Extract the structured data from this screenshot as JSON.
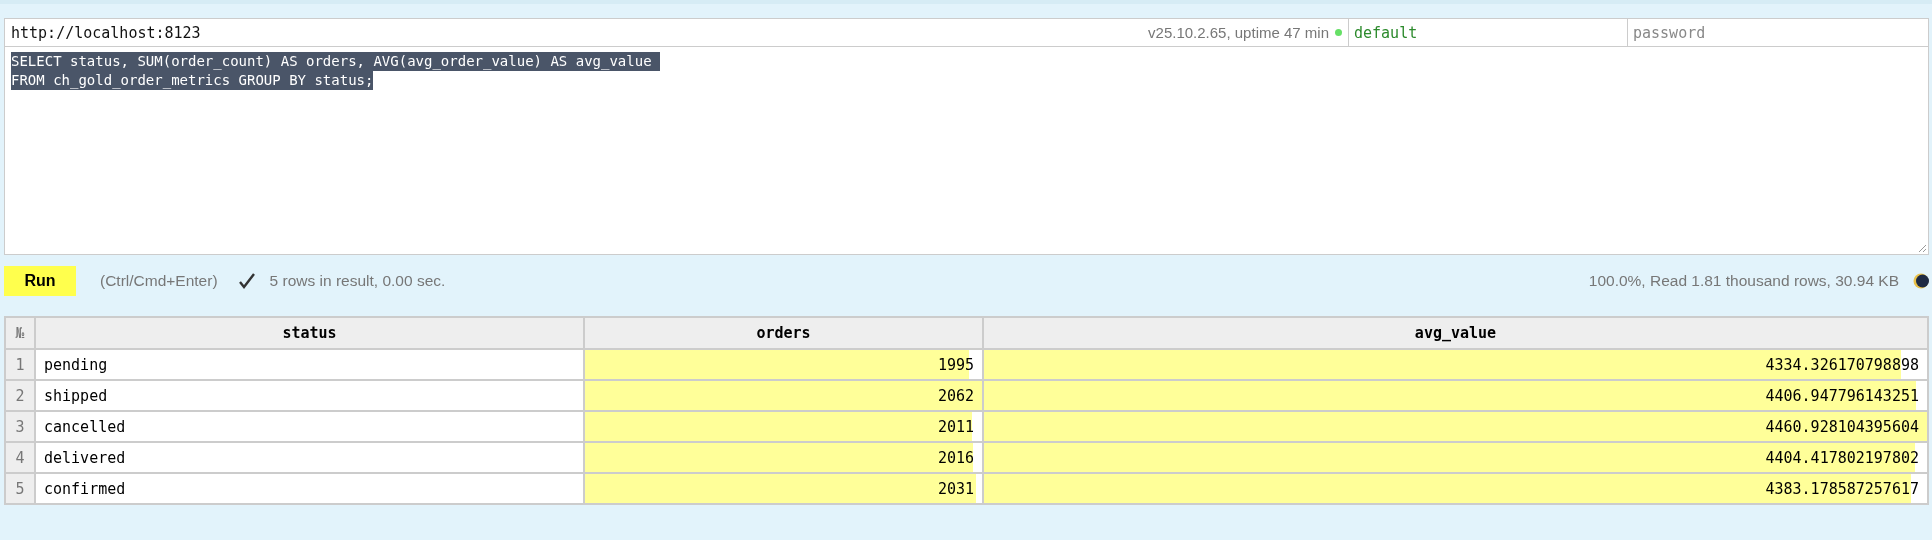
{
  "connection": {
    "url": "http://localhost:8123",
    "server_info": "v25.10.2.65, uptime 47 min",
    "online": true,
    "user": "default",
    "password_placeholder": "password"
  },
  "query": {
    "lines": [
      "SELECT status, SUM(order_count) AS orders, AVG(avg_order_value) AS avg_value ",
      "FROM ch_gold_order_metrics GROUP BY status;"
    ],
    "selected": true
  },
  "toolbar": {
    "run_label": "Run",
    "hint": "(Ctrl/Cmd+Enter)",
    "success": true,
    "result_summary": "5 rows in result, 0.00 sec.",
    "stats": "100.0%, Read 1.81 thousand rows, 30.94 KB"
  },
  "table": {
    "index_header": "№",
    "columns": [
      {
        "name": "status",
        "kind": "text"
      },
      {
        "name": "orders",
        "kind": "number"
      },
      {
        "name": "avg_value",
        "kind": "number"
      }
    ],
    "rows": [
      {
        "index": "1",
        "cells": [
          {
            "value": "pending"
          },
          {
            "value": "1995",
            "level": 0.967
          },
          {
            "value": "4334.326170798898",
            "level": 0.972
          }
        ]
      },
      {
        "index": "2",
        "cells": [
          {
            "value": "shipped"
          },
          {
            "value": "2062",
            "level": 1
          },
          {
            "value": "4406.947796143251",
            "level": 0.988
          }
        ]
      },
      {
        "index": "3",
        "cells": [
          {
            "value": "cancelled"
          },
          {
            "value": "2011",
            "level": 0.975
          },
          {
            "value": "4460.928104395604",
            "level": 1
          }
        ]
      },
      {
        "index": "4",
        "cells": [
          {
            "value": "delivered"
          },
          {
            "value": "2016",
            "level": 0.978
          },
          {
            "value": "4404.417802197802",
            "level": 0.987
          }
        ]
      },
      {
        "index": "5",
        "cells": [
          {
            "value": "confirmed"
          },
          {
            "value": "2031",
            "level": 0.985
          },
          {
            "value": "4383.178587257617",
            "level": 0.983
          }
        ]
      }
    ]
  }
}
